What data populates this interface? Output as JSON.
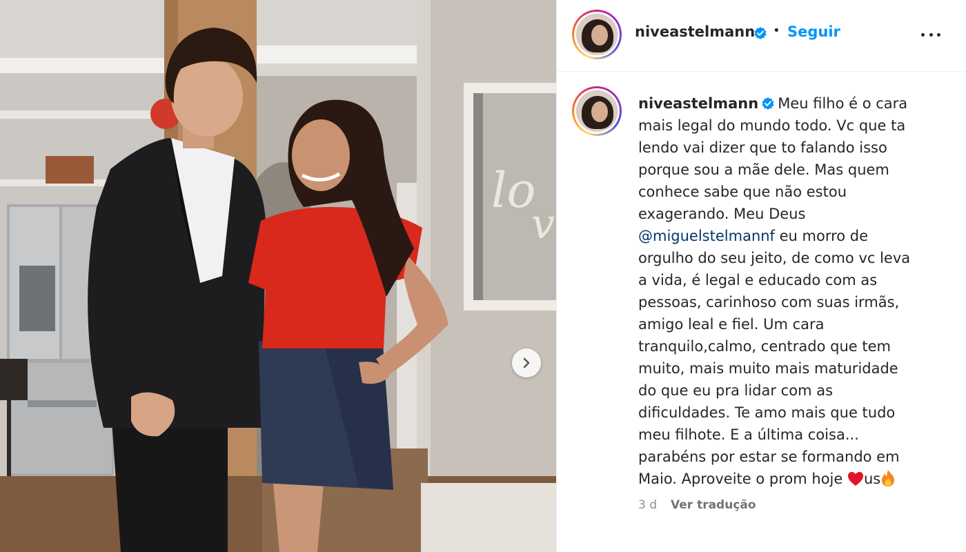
{
  "post": {
    "username": "niveastelmann",
    "follow_label": "Seguir",
    "separator": "•",
    "more_icon": "more-horizontal-icon",
    "verified_icon": "verified-badge-icon",
    "carousel_icon": "chevron-right-icon"
  },
  "caption": {
    "username": "niveastelmann",
    "lines": [
      "Meu filho é o cara",
      "mais legal do mundo todo. Vc que ta",
      "lendo vai dizer que to falando isso",
      "porque sou a mãe dele. Mas quem",
      "conhece sabe que não estou",
      "exagerando. Meu Deus"
    ],
    "mention": "@miguelstelmannf",
    "mention_tail": " eu morro de",
    "lines2": [
      "orgulho do seu jeito, de como vc leva",
      "a vida, é legal e educado com as",
      "pessoas, carinhoso com suas irmãs,",
      "amigo leal e fiel. Um cara",
      "tranquilo,calmo, centrado que tem",
      "muito, mais muito mais maturidade",
      "do que eu pra lidar com as",
      "dificuldades. Te amo mais que tudo",
      "meu filhote. E a última coisa...",
      "parabéns por estar se formando em"
    ],
    "last_line": "Maio. Aproveite o prom hoje ",
    "last_mid": "us",
    "emojis": [
      "red-heart-icon",
      "fire-icon"
    ]
  },
  "meta": {
    "time": "3 d",
    "translate_label": "Ver tradução"
  },
  "colors": {
    "accent": "#0095f6",
    "mention": "#00376b",
    "muted": "#8e8e8e"
  }
}
